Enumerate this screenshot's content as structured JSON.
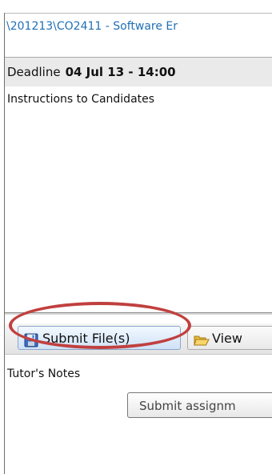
{
  "path": {
    "text": "\\201213\\CO2411 - Software Er"
  },
  "deadline": {
    "label": "Deadline",
    "value": "04 Jul 13 - 14:00"
  },
  "instructions": {
    "title": "Instructions to Candidates"
  },
  "toolbar": {
    "submit_label": "Submit File(s)",
    "view_label": "View",
    "submit_icon": "floppy-disk-icon",
    "view_icon": "folder-open-icon"
  },
  "notes": {
    "title": "Tutor's Notes"
  },
  "tooltip": {
    "text": "Submit assignm"
  },
  "colors": {
    "highlight": "#c0403f",
    "path_text": "#1f6fb5"
  }
}
